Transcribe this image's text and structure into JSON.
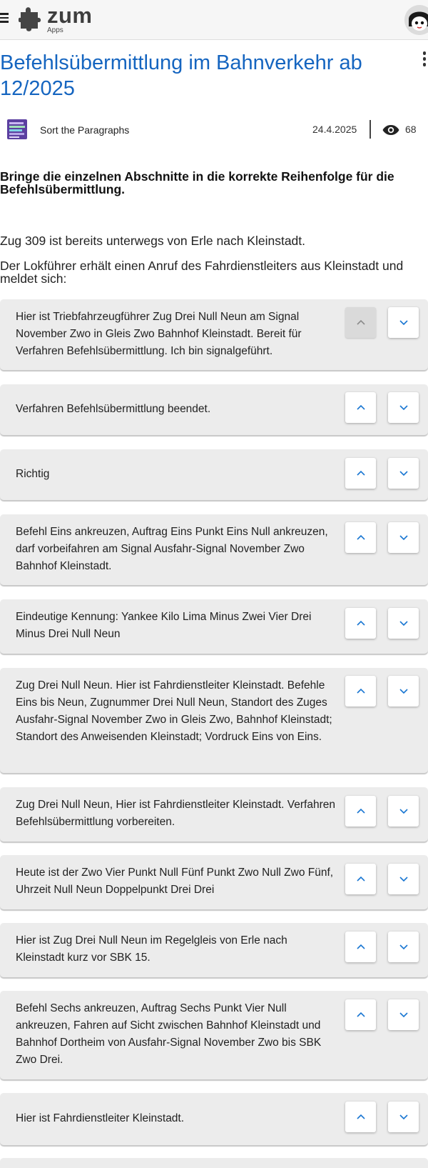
{
  "header": {
    "logo_text": "zum",
    "logo_sub": "Apps",
    "icons": [
      "menu-icon",
      "puzzle-logo-icon",
      "avatar",
      "more-vert-icon"
    ]
  },
  "page": {
    "title": "Befehlsübermittlung im Bahnverkehr ab 12/2025",
    "app_type": "Sort the Paragraphs",
    "date": "24.4.2025",
    "views": "68"
  },
  "task": "Bringe die einzelnen Abschnitte in die korrekte Reihenfolge für die Befehlsübermittlung.",
  "intro": [
    "Zug 309 ist bereits unterwegs von Erle nach Kleinstadt.",
    "Der Lokführer erhält einen Anruf des Fahrdienstleiters aus Kleinstadt und meldet sich:"
  ],
  "paragraphs": [
    "Hier ist Triebfahrzeugführer Zug Drei Null Neun am Signal November Zwo in Gleis Zwo Bahnhof Kleinstadt. Bereit für Verfahren Befehlsübermittlung. Ich bin signalgeführt.",
    "Verfahren Befehlsübermittlung beendet.",
    "Richtig",
    "Befehl Eins ankreuzen, Auftrag Eins Punkt Eins Null ankreuzen, darf vorbeifahren am Signal Ausfahr-Signal November Zwo Bahnhof Kleinstadt.",
    "Eindeutige Kennung: Yankee Kilo Lima Minus Zwei Vier Drei Minus Drei Null Neun",
    "Zug Drei Null Neun. Hier ist Fahrdienstleiter Kleinstadt. Befehle Eins bis Neun, Zugnummer Drei Null Neun, Standort des Zuges Ausfahr-Signal November Zwo in Gleis Zwo, Bahnhof Kleinstadt; Standort des Anweisenden Kleinstadt; Vordruck Eins von Eins.",
    "Zug Drei Null Neun, Hier ist Fahrdienstleiter Kleinstadt. Verfahren Befehlsübermittlung vorbereiten.",
    "Heute ist der Zwo Vier Punkt Null Fünf Punkt Zwo Null Zwo Fünf, Uhrzeit Null Neun Doppelpunkt Drei Drei",
    "Hier ist Zug Drei Null Neun im Regelgleis von Erle nach Kleinstadt kurz vor SBK 15.",
    "Befehl Sechs ankreuzen, Auftrag Sechs Punkt Vier Null ankreuzen, Fahren auf Sicht zwischen Bahnhof Kleinstadt und Bahnhof Dortheim von Ausfahr-Signal November Zwo bis SBK Zwo Drei.",
    "Hier ist Fahrdienstleiter Kleinstadt."
  ],
  "colors": {
    "title": "#1565c0",
    "card_bg": "#ececec",
    "arrow": "#1976d2",
    "disabled_btn": "#dadada"
  }
}
